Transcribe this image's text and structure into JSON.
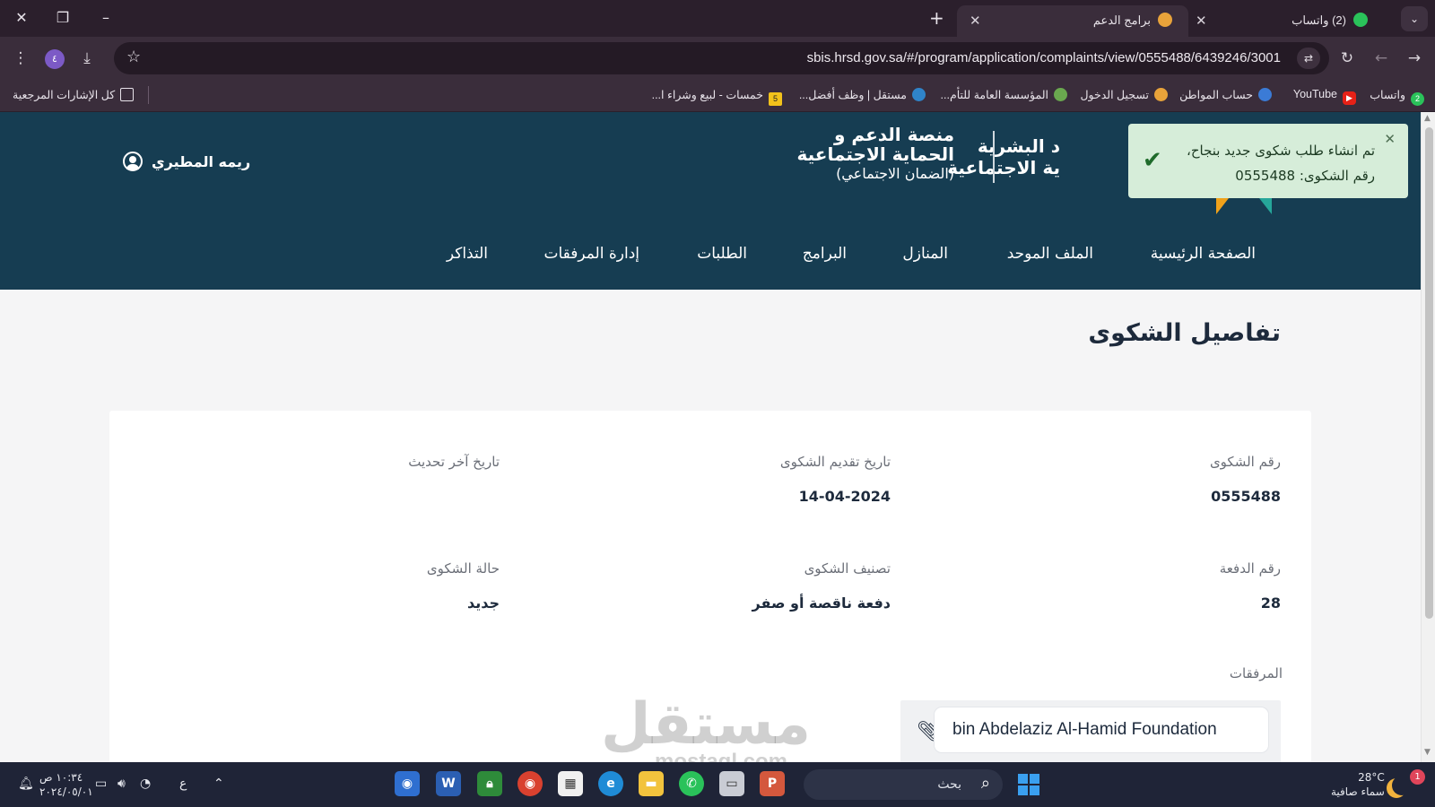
{
  "browser": {
    "tabs": [
      {
        "title": "برامج الدعم",
        "close": "✕",
        "active": true
      },
      {
        "title": "(2) واتساب",
        "close": "✕",
        "active": false
      }
    ],
    "new_tab": "+",
    "url": "sbis.hrsd.gov.sa/#/program/application/complaints/view/0555488/6439246/3001",
    "profile_initial": "٤",
    "bookmarks": [
      {
        "label": "واتساب",
        "badge": "2"
      },
      {
        "label": "YouTube"
      },
      {
        "label": "حساب المواطن"
      },
      {
        "label": "تسجيل الدخول"
      },
      {
        "label": "المؤسسة العامة للتأم..."
      },
      {
        "label": "مستقل | وظف أفضل..."
      },
      {
        "label": "خمسات - لبيع وشراء ا...",
        "badge": "5"
      },
      {
        "label": "كل الإشارات المرجعية"
      }
    ]
  },
  "header": {
    "ministry_line1": "د البشرية",
    "ministry_line2": "ية الاجتماعية",
    "platform_line1": "منصة الدعم و",
    "platform_line2": "الحماية الاجتماعية",
    "platform_line3": "(الضمان الاجتماعي)",
    "user_name": "ريمه المطيري",
    "nav": [
      "الصفحة الرئيسية",
      "الملف الموحد",
      "المنازل",
      "البرامج",
      "الطلبات",
      "إدارة المرفقات",
      "التذاكر"
    ]
  },
  "toast": {
    "line1": "تم انشاء طلب شكوى جديد بنجاح،",
    "line2": "رقم الشكوى: 0555488",
    "close": "✕",
    "check": "✔"
  },
  "content": {
    "title": "تفاصيل الشكوى",
    "fields": {
      "complaint_no_label": "رقم الشكوى",
      "complaint_no": "0555488",
      "submit_date_label": "تاريخ تقديم الشكوى",
      "submit_date": "14-04-2024",
      "last_update_label": "تاريخ آخر تحديث",
      "last_update": "",
      "payment_no_label": "رقم الدفعة",
      "payment_no": "28",
      "category_label": "تصنيف الشكوى",
      "category": "دفعة ناقصة أو صفر",
      "status_label": "حالة الشكوى",
      "status": "جديد"
    },
    "attachments_label": "المرفقات",
    "attachment_name": "bin Abdelaziz Al-Hamid Foundation"
  },
  "watermark": {
    "main": "مستقل",
    "sub": "mostaql.com"
  },
  "taskbar": {
    "search": "بحث",
    "time": "١٠:٣٤ ص",
    "date": "٢٠٢٤/٠٥/٠١",
    "lang": "ع",
    "temperature": "28°C",
    "weather": "سماء صافية",
    "notif_count": "1"
  },
  "colors": {
    "header_bg": "#163d52",
    "toast_bg": "#d6edd9",
    "chrome_bg": "#3a2d3b",
    "taskbar_bg": "#1f2437"
  }
}
